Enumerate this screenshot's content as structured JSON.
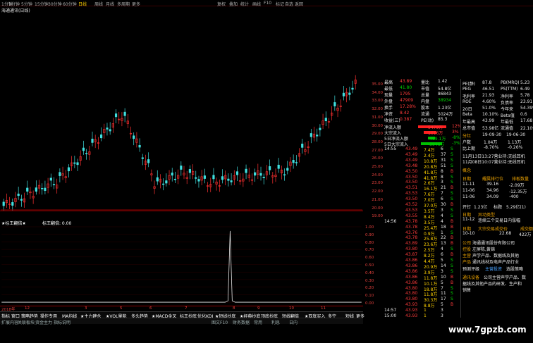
{
  "topbar": {
    "items": [
      "1分钟",
      "1分钟",
      "5分钟",
      "15分钟",
      "30分钟",
      "60分钟",
      "日线",
      "周线",
      "月线",
      "多周期",
      "更多",
      "复权",
      "叠加",
      "统计",
      "画线",
      "F10",
      "标记",
      "自选",
      "返回"
    ],
    "active_index": 6
  },
  "stock_title": "海通通讯(日线)",
  "price_axis": [
    "35.00",
    "34.00",
    "33.00",
    "32.00",
    "31.00",
    "30.00",
    "29.00",
    "28.00",
    "27.00",
    "26.00",
    "25.00",
    "24.00",
    "23.00",
    "22.00",
    "21.00",
    "20.00",
    "19.00"
  ],
  "indicator": {
    "name": "★标王翻倍★",
    "value_label": "标王翻倍: 0.00",
    "axis": [
      "1.00",
      "0.90",
      "0.80",
      "0.70",
      "0.60",
      "0.50",
      "0.40",
      "0.30",
      "0.20",
      "0.10",
      "0.00"
    ]
  },
  "dates": [
    "2018年",
    "12",
    "3",
    "5",
    "6",
    "7",
    "8",
    "9",
    "10",
    "11"
  ],
  "tabs": [
    "指标",
    "窗口",
    "策略趋势",
    "操作专用",
    "MA均线",
    "★主力建仓",
    "★VOL量能",
    "多头趋势",
    "★MACD金叉",
    "标王抄底",
    "优化KDJ",
    "★短线抄底",
    "★经典抄底",
    "顶底抄底",
    "短线翻倍",
    "★双底买入",
    "多空",
    "短线",
    "更多"
  ],
  "status": [
    "扩展内容",
    "关联板块",
    "资金主力",
    "指标说明",
    "图文F10",
    "财务数据",
    "常用",
    "利息",
    "日内"
  ],
  "quote": {
    "rows": [
      {
        "l": "最高",
        "v": "43.89",
        "l2": "量比",
        "v2": "1.42"
      },
      {
        "l": "最低",
        "v": "41.80",
        "l2": "市值",
        "v2": "54.8亿"
      },
      {
        "l": "现量",
        "v": "1795",
        "l2": "总量",
        "v2": "86843"
      },
      {
        "l": "外盘",
        "v": "47909",
        "l2": "内盘",
        "v2": "38934"
      },
      {
        "l": "换手",
        "v": "17.28%",
        "l2": "股本",
        "v2": "1.23亿"
      },
      {
        "l": "净资",
        "v": "8.42",
        "l2": "流通",
        "v2": "5024万"
      },
      {
        "l": "收益(三)",
        "v": "0.387",
        "l2": "PE(动)",
        "v2": "85.3"
      }
    ],
    "funds": [
      {
        "l": "净流入额",
        "v": "5479万",
        "p": "12%"
      },
      {
        "l": "大宗流入",
        "v": "1016万",
        "p": "3%"
      },
      {
        "l": "5日净流入额",
        "v": "-469.1万",
        "p": "-8%"
      },
      {
        "l": "5日大宗流入",
        "v": "-3946万",
        "p": "-3%"
      }
    ]
  },
  "ticks": [
    {
      "t": "14:55",
      "p": "43.49",
      "v": "7.4万",
      "n": "6",
      "d": "S"
    },
    {
      "t": "",
      "p": "43.49",
      "v": "2.4万",
      "n": "37",
      "d": "S"
    },
    {
      "t": "",
      "p": "43.49",
      "v": "10.8万",
      "n": "31",
      "d": "S"
    },
    {
      "t": "",
      "p": "43.48",
      "v": "20.8万",
      "n": "51",
      "d": "S"
    },
    {
      "t": "",
      "p": "43.50",
      "v": "41.8万",
      "n": "8",
      "d": "B"
    },
    {
      "t": "",
      "p": "43.50",
      "v": "41.8万",
      "n": "8",
      "d": "S"
    },
    {
      "t": "",
      "p": "43.50",
      "v": "2.6万",
      "n": "3",
      "d": "S"
    },
    {
      "t": "",
      "p": "43.51",
      "v": "16.1万",
      "n": "21",
      "d": "B"
    },
    {
      "t": "",
      "p": "43.53",
      "v": "7.6万",
      "n": "7",
      "d": "S"
    },
    {
      "t": "",
      "p": "43.50",
      "v": "7.0万",
      "n": "6",
      "d": "S"
    },
    {
      "t": "",
      "p": "43.52",
      "v": "37.0万",
      "n": "30",
      "d": "B"
    },
    {
      "t": "",
      "p": "43.53",
      "v": "3.5万",
      "n": "3",
      "d": "S"
    },
    {
      "t": "",
      "p": "43.55",
      "v": "8.4万",
      "n": "4",
      "d": "S"
    },
    {
      "t": "14:56",
      "p": "43.78",
      "v": "3.5万",
      "n": "4",
      "d": "B"
    },
    {
      "t": "",
      "p": "43.78",
      "v": "25.4万",
      "n": "18",
      "d": "B"
    },
    {
      "t": "",
      "p": "43.76",
      "v": "0.9万",
      "n": "1",
      "d": "S"
    },
    {
      "t": "",
      "p": "43.78",
      "v": "25.8万",
      "n": "22",
      "d": "B"
    },
    {
      "t": "",
      "p": "43.89",
      "v": "23.6万",
      "n": "13",
      "d": "B"
    },
    {
      "t": "",
      "p": "43.80",
      "v": "2.5万",
      "n": "4",
      "d": "S"
    },
    {
      "t": "",
      "p": "43.87",
      "v": "8.2万",
      "n": "6",
      "d": "B"
    },
    {
      "t": "",
      "p": "43.86",
      "v": "4.4万",
      "n": "5",
      "d": "S"
    },
    {
      "t": "",
      "p": "43.86",
      "v": "20.9万",
      "n": "14",
      "d": "S"
    },
    {
      "t": "",
      "p": "43.86",
      "v": "3.9万",
      "n": "3",
      "d": "S"
    },
    {
      "t": "",
      "p": "43.86",
      "v": "11.8万",
      "n": "10",
      "d": "B"
    },
    {
      "t": "",
      "p": "43.86",
      "v": "10.1万",
      "n": "5",
      "d": "B"
    },
    {
      "t": "",
      "p": "43.80",
      "v": "18.8万",
      "n": "7",
      "d": "S"
    },
    {
      "t": "",
      "p": "43.80",
      "v": "11.8万",
      "n": "11",
      "d": "S"
    },
    {
      "t": "",
      "p": "43.80",
      "v": "30.3万",
      "n": "17",
      "d": "S"
    },
    {
      "t": "",
      "p": "43.93",
      "v": "8.8万",
      "n": "5",
      "d": "B"
    },
    {
      "t": "14:57",
      "p": "43.93",
      "v": "1",
      "n": "3",
      "d": ""
    },
    {
      "t": "15:00",
      "p": "43.93",
      "v": "1",
      "n": "3",
      "d": ""
    }
  ],
  "info": {
    "top": [
      {
        "l": "PE(静)",
        "v": "87.8",
        "l2": "PB(MRQ)",
        "v2": "5.23"
      },
      {
        "l": "PEG",
        "v": "46.51",
        "l2": "PS(TTM)",
        "v2": "6.49"
      },
      {
        "l": "毛利率",
        "v": "21.93",
        "l2": "净利率",
        "v2": "5.78"
      },
      {
        "l": "ROE",
        "v": "4.60%",
        "l2": "负债率",
        "v2": "23.91"
      },
      {
        "l": "20日",
        "v": "51.0%",
        "l2": "今年来",
        "v2": "54.39%"
      },
      {
        "l": "Beta",
        "v": "10.10%",
        "l2": "Beta值",
        "v2": "0.6"
      },
      {
        "l": "年最高",
        "v": "43.99",
        "l2": "年最低",
        "v2": "17.68"
      },
      {
        "l": "总市值",
        "v": "53.98亿",
        "l2": "流通值",
        "v2": "22.10亿"
      }
    ],
    "dividend": {
      "head": "分红",
      "cols": [
        "19-09-30",
        "19-06-30"
      ]
    },
    "eps_rows": [
      {
        "l": "户数",
        "v": "1.04万",
        "v2": "1.13万"
      },
      {
        "l": "比上期",
        "v": "-8.70%",
        "v2": "-0.26%"
      }
    ],
    "news": [
      "11月13日13:27营业持:无线耳机",
      "11月08日10:07营业持:无线耳机"
    ],
    "block_head": "概念",
    "rank_head": [
      "日期",
      "耀属排行位",
      "排板数量"
    ],
    "rank_rows": [
      {
        "d": "11-11",
        "a": "39.16",
        "b": "-2.09万"
      },
      {
        "d": "11-06",
        "a": "34.96",
        "b": "-12.35万"
      },
      {
        "d": "11-06",
        "a": "34.09",
        "b": "-400"
      }
    ],
    "market": {
      "l": "开钉",
      "v": "1.23亿",
      "l2": "标题",
      "v2": "5.29亿(1)"
    },
    "alert_head": [
      "日期",
      "异动类型"
    ],
    "alert_row": {
      "d": "11-12",
      "t": "连续三个交易日内涨幅"
    },
    "block_trade_head": [
      "日期",
      "大宗交易成交价",
      "成交额"
    ],
    "block_trade_row": {
      "d": "10-10",
      "p": "22.68",
      "a": "422万"
    },
    "company": {
      "company_label": "公司",
      "company_val": "海通通讯股份有限公司",
      "ctrl_label": "控股",
      "ctrl_val": "左屏陈,黄锦",
      "biz_label": "主营",
      "biz_val": "声学产品、数据线及其他",
      "prod_label": "产品",
      "prod_val": "通讯线材及电声产品行业"
    },
    "f10_tabs": [
      "预测评级",
      "主营投资",
      "选股策略"
    ],
    "desc_head": "通讯设备",
    "desc": [
      "公司主营声学产品、数",
      "据线及其他产品的研发、生产和",
      "销售"
    ]
  },
  "watermark": "www.7gpzb.com"
}
